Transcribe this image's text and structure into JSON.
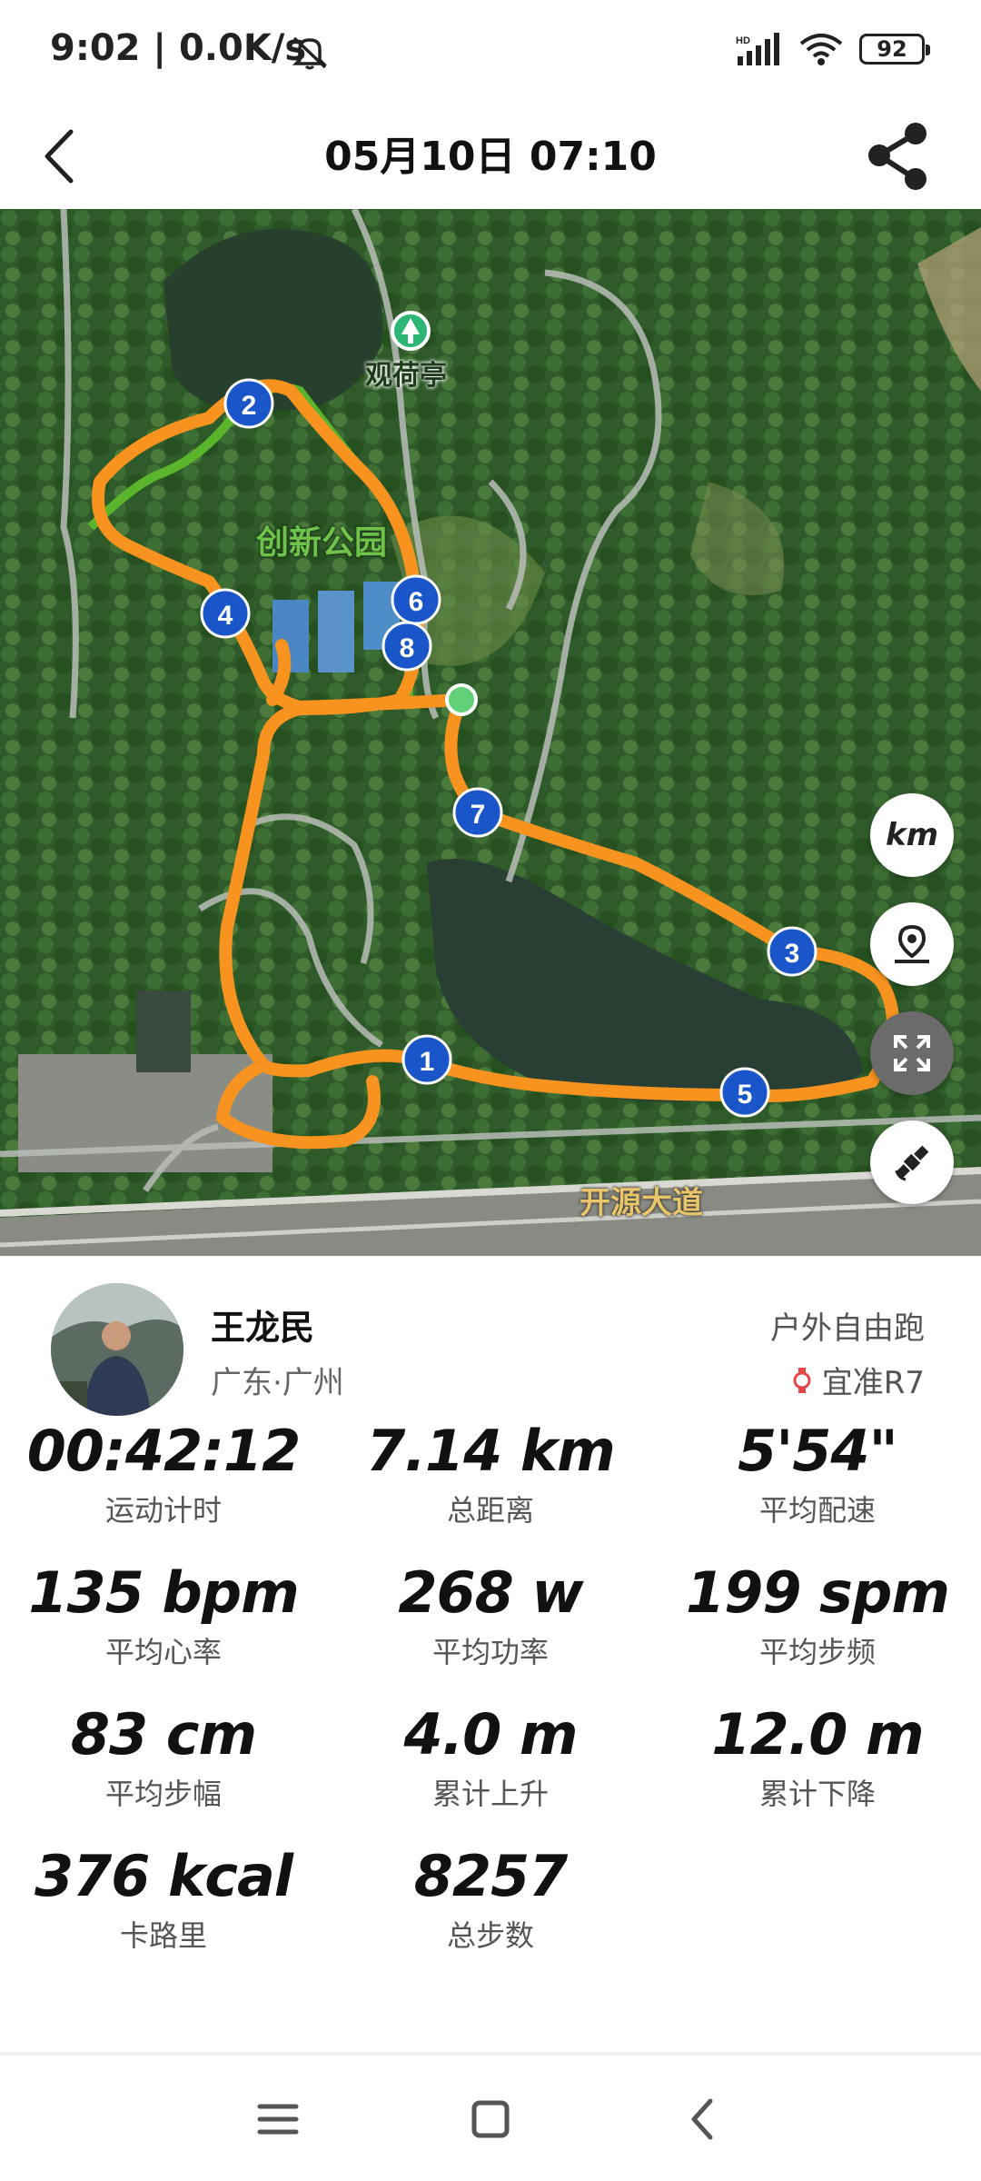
{
  "status_bar": {
    "time": "9:02 | 0.0K/s",
    "battery": "92"
  },
  "header": {
    "title": "05月10日 07:10"
  },
  "map": {
    "labels": {
      "pavilion": "观荷亭",
      "park": "创新公园",
      "road": "开源大道"
    },
    "markers": [
      "1",
      "2",
      "3",
      "4",
      "5",
      "6",
      "7",
      "8"
    ],
    "unit_button": "km",
    "route_color": "#f7931e",
    "route_alt_color": "#5ab52c"
  },
  "profile": {
    "name": "王龙民",
    "location": "广东·广州",
    "activity": "户外自由跑",
    "device": "宜准R7"
  },
  "stats": [
    {
      "value": "00:42:12",
      "label": "运动计时"
    },
    {
      "value": "7.14 km",
      "label": "总距离"
    },
    {
      "value": "5'54\"",
      "label": "平均配速"
    },
    {
      "value": "135 bpm",
      "label": "平均心率"
    },
    {
      "value": "268 w",
      "label": "平均功率"
    },
    {
      "value": "199 spm",
      "label": "平均步频"
    },
    {
      "value": "83 cm",
      "label": "平均步幅"
    },
    {
      "value": "4.0 m",
      "label": "累计上升"
    },
    {
      "value": "12.0 m",
      "label": "累计下降"
    },
    {
      "value": "376 kcal",
      "label": "卡路里"
    },
    {
      "value": "8257",
      "label": "总步数"
    }
  ]
}
